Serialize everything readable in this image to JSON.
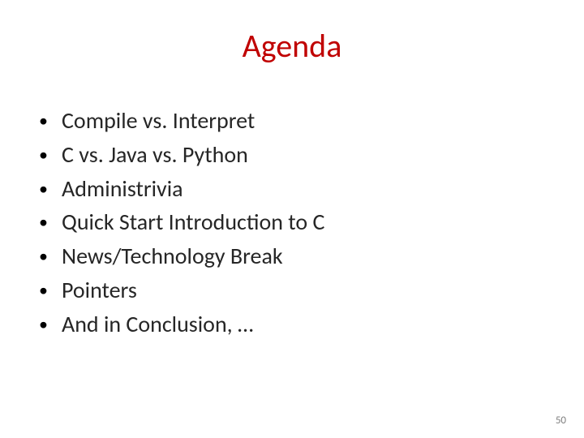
{
  "title": "Agenda",
  "bullets": [
    "Compile vs. Interpret",
    "C vs. Java vs. Python",
    "Administrivia",
    "Quick Start Introduction to C",
    "News/Technology Break",
    "Pointers",
    "And in Conclusion, …"
  ],
  "page_number": "50"
}
